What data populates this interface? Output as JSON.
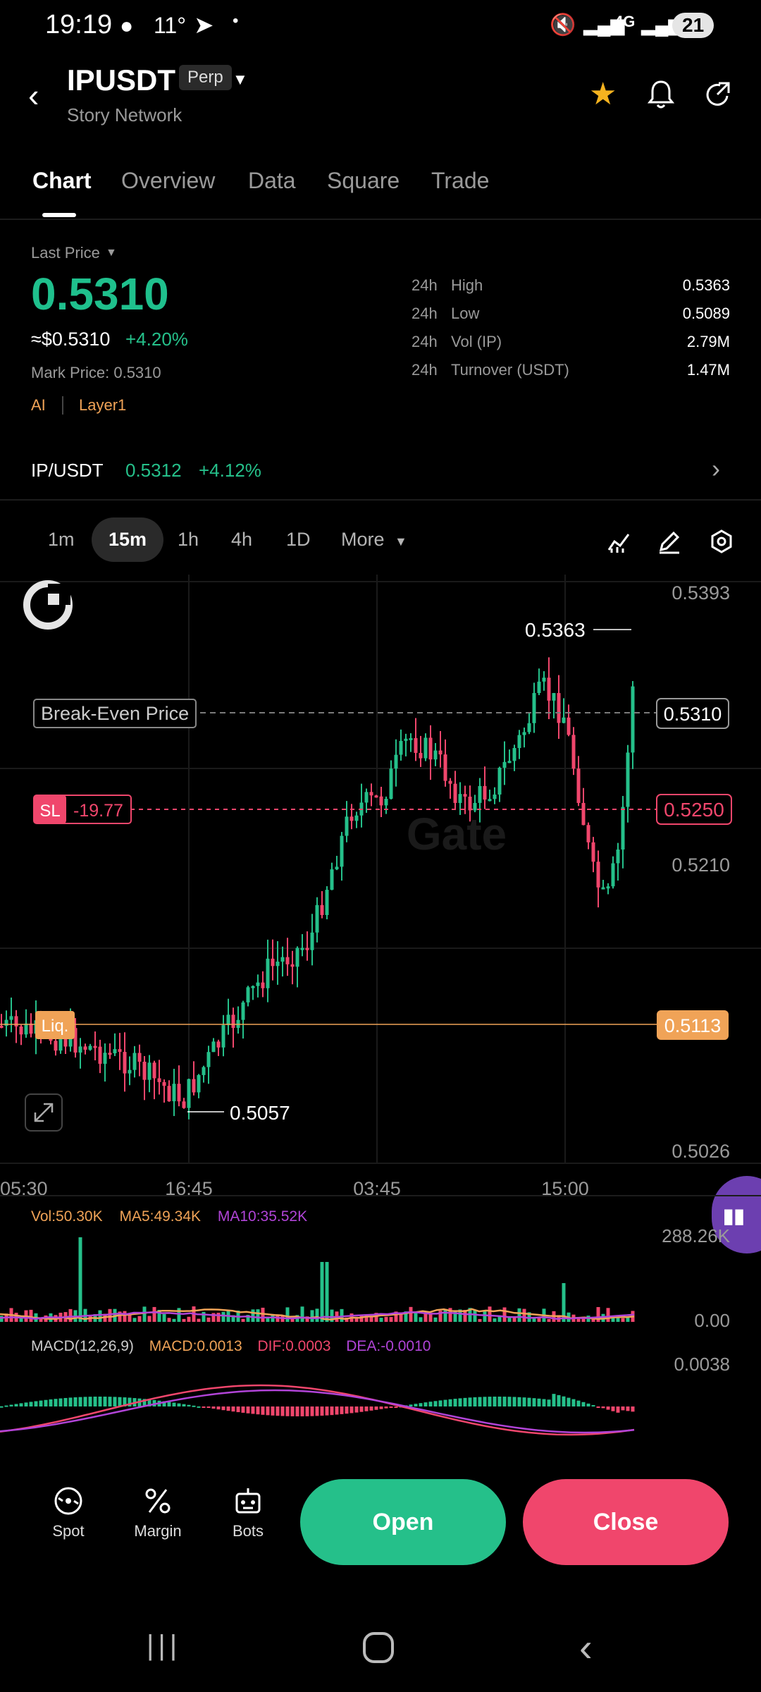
{
  "status_bar": {
    "time": "19:19",
    "temp": "11°",
    "network": "4G",
    "battery": "21"
  },
  "header": {
    "symbol": "IPUSDT",
    "badge": "Perp",
    "subtitle": "Story Network"
  },
  "tabs": [
    {
      "label": "Chart"
    },
    {
      "label": "Overview"
    },
    {
      "label": "Data"
    },
    {
      "label": "Square"
    },
    {
      "label": "Trade"
    }
  ],
  "price_panel": {
    "last_price_label": "Last Price",
    "last_price": "0.5310",
    "approx_usd": "≈$0.5310",
    "change": "+4.20%",
    "mark_price": "Mark Price: 0.5310",
    "tags": [
      "AI",
      "Layer1"
    ],
    "stats": [
      {
        "period": "24h",
        "label": "High",
        "value": "0.5363"
      },
      {
        "period": "24h",
        "label": "Low",
        "value": "0.5089"
      },
      {
        "period": "24h",
        "label": "Vol (IP)",
        "value": "2.79M"
      },
      {
        "period": "24h",
        "label": "Turnover (USDT)",
        "value": "1.47M"
      }
    ]
  },
  "spot_pair": {
    "pair": "IP/USDT",
    "price": "0.5312",
    "change": "+4.12%"
  },
  "timeframes": [
    {
      "label": "1m"
    },
    {
      "label": "15m"
    },
    {
      "label": "1h"
    },
    {
      "label": "4h"
    },
    {
      "label": "1D"
    },
    {
      "label": "More"
    }
  ],
  "chart": {
    "yticks": [
      "0.5393",
      "0.5210",
      "0.5026"
    ],
    "xticks": [
      "05:30",
      "16:45",
      "03:45",
      "15:00"
    ],
    "high_label": "0.5363",
    "low_label": "0.5057",
    "break_even_label": "Break-Even Price",
    "break_even_value": "0.5310",
    "sl_label": "SL",
    "sl_pnl": "-19.77",
    "sl_value": "0.5250",
    "liq_label": "Liq.",
    "liq_value": "0.5113"
  },
  "volume": {
    "vol": "Vol:50.30K",
    "ma5": "MA5:49.34K",
    "ma10": "MA10:35.52K",
    "max": "288.26K",
    "min": "0.00"
  },
  "macd": {
    "name": "MACD(12,26,9)",
    "macd": "MACD:0.0013",
    "dif": "DIF:0.0003",
    "dea": "DEA:-0.0010",
    "top": "0.0038"
  },
  "bottom_bar": {
    "spot": "Spot",
    "margin": "Margin",
    "bots": "Bots",
    "open": "Open",
    "close": "Close"
  },
  "colors": {
    "up": "#25c08a",
    "down": "#f0466c",
    "accent_orange": "#f0a357",
    "star": "#f5b31f"
  }
}
